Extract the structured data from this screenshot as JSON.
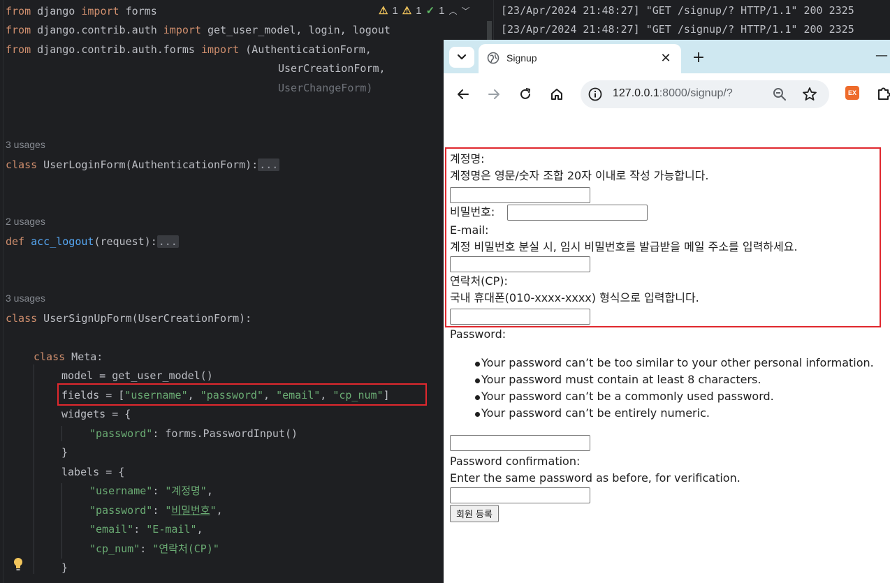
{
  "ide": {
    "inspections": {
      "warnings_a": "1",
      "warnings_b": "1",
      "ok_count": "1"
    },
    "code": {
      "l1_from": "from",
      "l1_mod": " django ",
      "l1_import": "import",
      "l1_rest": " forms",
      "l2_from": "from",
      "l2_mod": " django.contrib.auth ",
      "l2_import": "import",
      "l2_rest": " get_user_model, login, logout",
      "l3_from": "from",
      "l3_mod": " django.contrib.auth.forms ",
      "l3_import": "import",
      "l3_rest": " (AuthenticationForm,",
      "l4": "UserCreationForm,",
      "l5": "UserChangeForm)",
      "l5_close": ")",
      "usages_1": "3 usages",
      "l6_class": "class",
      "l6_name": " UserLoginForm(AuthenticationForm):",
      "l6_fold": "...",
      "usages_2": "2 usages",
      "l7_def": "def",
      "l7_fn": " acc_logout",
      "l7_rest": "(request):",
      "l7_fold": "...",
      "usages_3": "3 usages",
      "l8_class": "class",
      "l8_rest": " UserSignUpForm(UserCreationForm):",
      "l9_class": "class",
      "l9_rest": " Meta:",
      "l10": "model = get_user_model()",
      "l11_pre": "fields = [",
      "l11_s1": "\"username\"",
      "l11_c1": ", ",
      "l11_s2": "\"password\"",
      "l11_c2": ", ",
      "l11_s3": "\"email\"",
      "l11_c3": ", ",
      "l11_s4": "\"cp_num\"",
      "l11_post": "]",
      "l12": "widgets = {",
      "l13_key": "\"password\"",
      "l13_rest": ": forms.PasswordInput()",
      "l14": "}",
      "l15": "labels = {",
      "l16_key": "\"username\"",
      "l16_sep": ": ",
      "l16_val": "\"계정명\"",
      "l16_end": ",",
      "l17_key": "\"password\"",
      "l17_sep": ": ",
      "l17_q1": "\"",
      "l17_val": "비밀번호",
      "l17_q2": "\"",
      "l17_end": ",",
      "l18_key": "\"email\"",
      "l18_sep": ": ",
      "l18_val": "\"E-mail\"",
      "l18_end": ",",
      "l19_key": "\"cp_num\"",
      "l19_sep": ": ",
      "l19_val": "\"연락처(CP)\"",
      "l20": "}"
    }
  },
  "console": {
    "lines": [
      "[23/Apr/2024 21:48:27] \"GET /signup/? HTTP/1.1\" 200 2325",
      "[23/Apr/2024 21:48:27] \"GET /signup/? HTTP/1.1\" 200 2325"
    ]
  },
  "browser": {
    "tab_title": "Signup",
    "tab_close": "✕",
    "new_tab": "+",
    "minimize": "—",
    "url_host": "127.0.0.1",
    "url_rest": ":8000/signup/?",
    "ext_label": "EX"
  },
  "form": {
    "username_label": "계정명:",
    "username_help": "계정명은 영문/숫자 조합 20자 이내로 작성 가능합니다.",
    "password_label": "비밀번호:",
    "email_label": "E-mail:",
    "email_help": "계정 비밀번호 분실 시, 임시 비밀번호를 발급받을 메일 주소를 입력하세요.",
    "cp_label": "연락처(CP):",
    "cp_help": "국내 휴대폰(010-xxxx-xxxx) 형식으로 입력합니다.",
    "password1_label": "Password:",
    "password_hints": [
      "Your password can’t be too similar to your other personal information.",
      "Your password must contain at least 8 characters.",
      "Your password can’t be a commonly used password.",
      "Your password can’t be entirely numeric."
    ],
    "password2_label": "Password confirmation:",
    "password2_help": "Enter the same password as before, for verification.",
    "submit_label": "회원 등록"
  }
}
